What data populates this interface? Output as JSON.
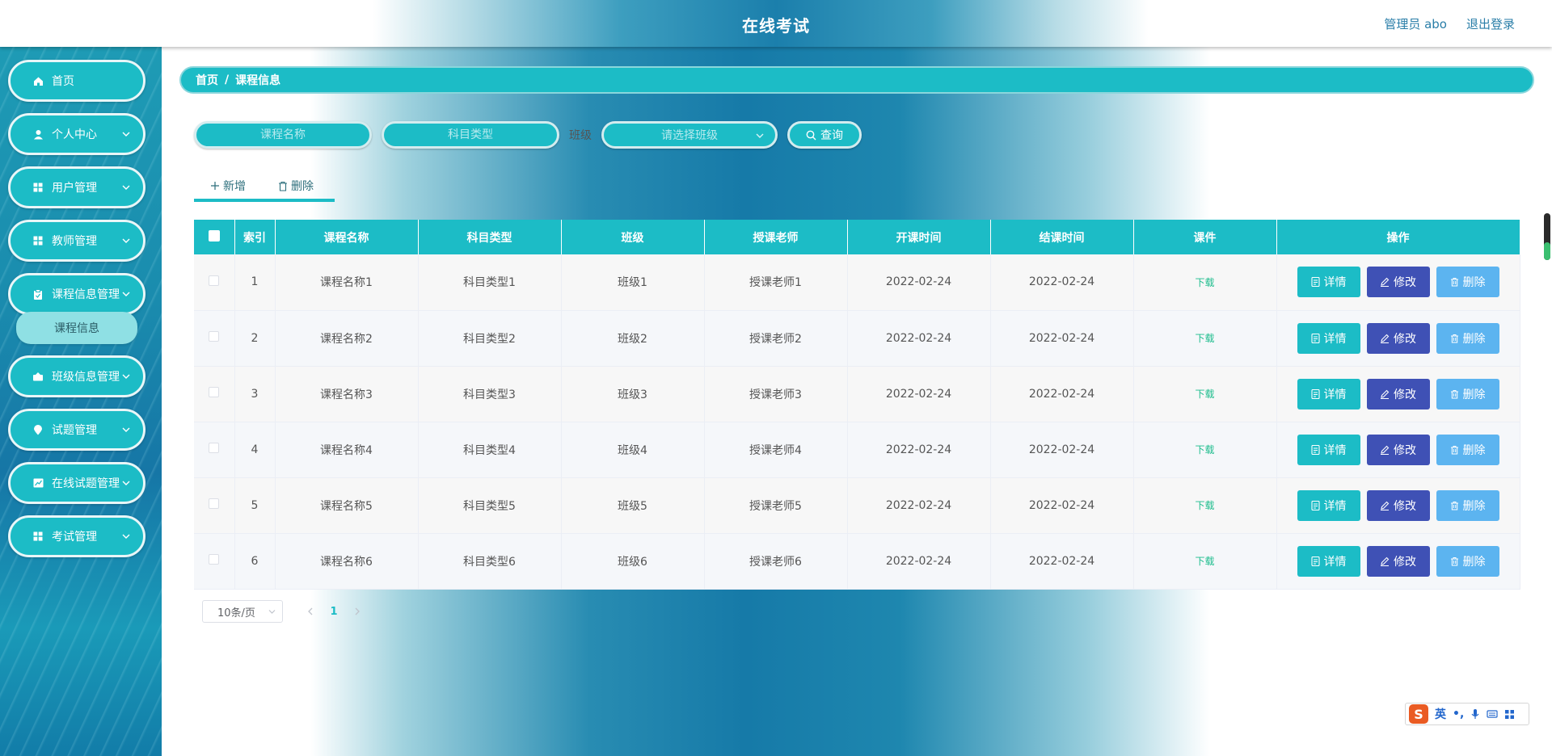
{
  "header": {
    "title": "在线考试",
    "user": "管理员 abo",
    "logout": "退出登录"
  },
  "sidebar": {
    "items": [
      {
        "label": "首页",
        "icon": "home-icon",
        "has_arrow": false
      },
      {
        "label": "个人中心",
        "icon": "user-icon",
        "has_arrow": true
      },
      {
        "label": "用户管理",
        "icon": "grid-icon",
        "has_arrow": true
      },
      {
        "label": "教师管理",
        "icon": "grid-icon",
        "has_arrow": true
      },
      {
        "label": "课程信息管理",
        "icon": "clipboard-icon",
        "has_arrow": true
      },
      {
        "label": "班级信息管理",
        "icon": "briefcase-icon",
        "has_arrow": true
      },
      {
        "label": "试题管理",
        "icon": "location-icon",
        "has_arrow": true
      },
      {
        "label": "在线试题管理",
        "icon": "chart-icon",
        "has_arrow": true
      },
      {
        "label": "考试管理",
        "icon": "grid-icon",
        "has_arrow": true
      }
    ],
    "active_submenu": "课程信息"
  },
  "breadcrumb": {
    "home": "首页",
    "separator": "/",
    "current": "课程信息"
  },
  "search": {
    "course_name_placeholder": "课程名称",
    "subject_type_placeholder": "科目类型",
    "class_label": "班级",
    "class_select_placeholder": "请选择班级",
    "query_label": "查询"
  },
  "actions": {
    "add_label": "新增",
    "delete_label": "删除"
  },
  "table": {
    "headers": [
      "索引",
      "课程名称",
      "科目类型",
      "班级",
      "授课老师",
      "开课时间",
      "结课时间",
      "课件",
      "操作"
    ],
    "rows": [
      {
        "index": "1",
        "name": "课程名称1",
        "subject": "科目类型1",
        "class": "班级1",
        "teacher": "授课老师1",
        "start": "2022-02-24",
        "end": "2022-02-24",
        "file": "下载"
      },
      {
        "index": "2",
        "name": "课程名称2",
        "subject": "科目类型2",
        "class": "班级2",
        "teacher": "授课老师2",
        "start": "2022-02-24",
        "end": "2022-02-24",
        "file": "下载"
      },
      {
        "index": "3",
        "name": "课程名称3",
        "subject": "科目类型3",
        "class": "班级3",
        "teacher": "授课老师3",
        "start": "2022-02-24",
        "end": "2022-02-24",
        "file": "下载"
      },
      {
        "index": "4",
        "name": "课程名称4",
        "subject": "科目类型4",
        "class": "班级4",
        "teacher": "授课老师4",
        "start": "2022-02-24",
        "end": "2022-02-24",
        "file": "下载"
      },
      {
        "index": "5",
        "name": "课程名称5",
        "subject": "科目类型5",
        "class": "班级5",
        "teacher": "授课老师5",
        "start": "2022-02-24",
        "end": "2022-02-24",
        "file": "下载"
      },
      {
        "index": "6",
        "name": "课程名称6",
        "subject": "科目类型6",
        "class": "班级6",
        "teacher": "授课老师6",
        "start": "2022-02-24",
        "end": "2022-02-24",
        "file": "下载"
      }
    ],
    "op_labels": {
      "detail": "详情",
      "edit": "修改",
      "delete": "删除"
    }
  },
  "pagination": {
    "page_size": "10条/页",
    "current_page": "1"
  },
  "ime": {
    "mode": "英"
  },
  "colors": {
    "accent": "#1cbcc6",
    "edit": "#3f51b5",
    "delete": "#5cb4f0",
    "download": "#1cbc8c"
  }
}
